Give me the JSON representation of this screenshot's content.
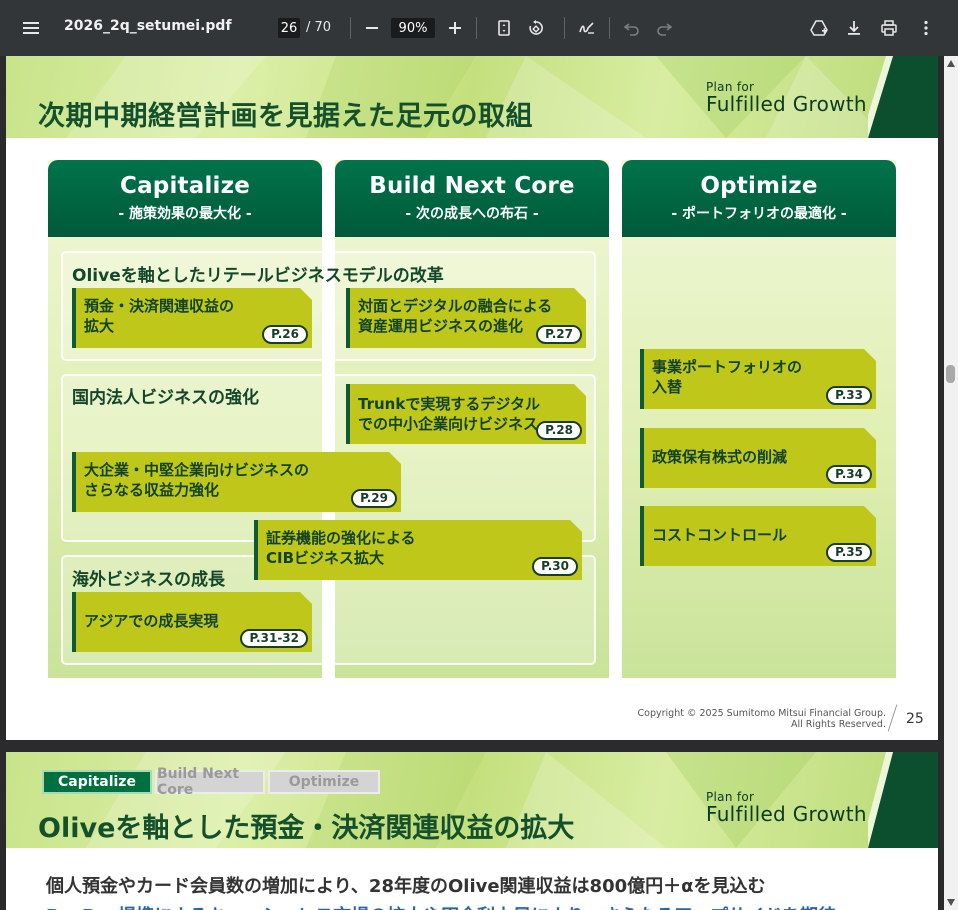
{
  "viewer": {
    "file_name": "2026_2q_setumei.pdf",
    "current_page": "26",
    "total_pages": "/ 70",
    "zoom": "90%"
  },
  "slide1": {
    "title": "次期中期経営計画を見据えた足元の取組",
    "brand_small": "Plan for",
    "brand_big": "Fulfilled Growth",
    "columns": [
      {
        "title": "Capitalize",
        "subtitle": "- 施策効果の最大化 -"
      },
      {
        "title": "Build Next Core",
        "subtitle": "- 次の成長への布石 -"
      },
      {
        "title": "Optimize",
        "subtitle": "- ポートフォリオの最適化 -"
      }
    ],
    "groups": [
      {
        "title": "Oliveを軸としたリテールビジネスモデルの改革"
      },
      {
        "title": "国内法人ビジネスの強化"
      },
      {
        "title": "海外ビジネスの成長"
      }
    ],
    "items": [
      {
        "line1": "預金・決済関連収益の",
        "line2": "拡大",
        "page": "P.26"
      },
      {
        "line1": "対面とデジタルの融合による",
        "line2": "資産運用ビジネスの進化",
        "page": "P.27"
      },
      {
        "line1": "Trunkで実現するデジタル",
        "line2": "での中小企業向けビジネス",
        "page": "P.28"
      },
      {
        "line1": "大企業・中堅企業向けビジネスの",
        "line2": "さらなる収益力強化",
        "page": "P.29"
      },
      {
        "line1": "証券機能の強化による",
        "line2": "CIBビジネス拡大",
        "page": "P.30"
      },
      {
        "line1": "アジアでの成長実現",
        "line2": "",
        "page": "P.31-32"
      },
      {
        "line1": "事業ポートフォリオの",
        "line2": "入替",
        "page": "P.33"
      },
      {
        "line1": "政策保有株式の削減",
        "line2": "",
        "page": "P.34"
      },
      {
        "line1": "コストコントロール",
        "line2": "",
        "page": "P.35"
      }
    ],
    "copyright_line1": "Copyright © 2025 Sumitomo Mitsui Financial Group.",
    "copyright_line2": "All Rights Reserved.",
    "page_number": "25"
  },
  "slide2": {
    "tabs": [
      "Capitalize",
      "Build Next Core",
      "Optimize"
    ],
    "title": "Oliveを軸とした預金・決済関連収益の拡大",
    "brand_small": "Plan for",
    "brand_big": "Fulfilled Growth",
    "lead1": "個人預金やカード会員数の増加により、28年度のOlive関連収益は800億円＋αを見込む",
    "lead2": "PayPay提携によるキャッシュレス市場の拡大や円金利上昇により、さらなるアップサイドを期待"
  },
  "colors": {
    "toolbar": "#323639",
    "header_green": "#006b44",
    "item_olive": "#bfc81a",
    "title_green": "#14502c"
  }
}
